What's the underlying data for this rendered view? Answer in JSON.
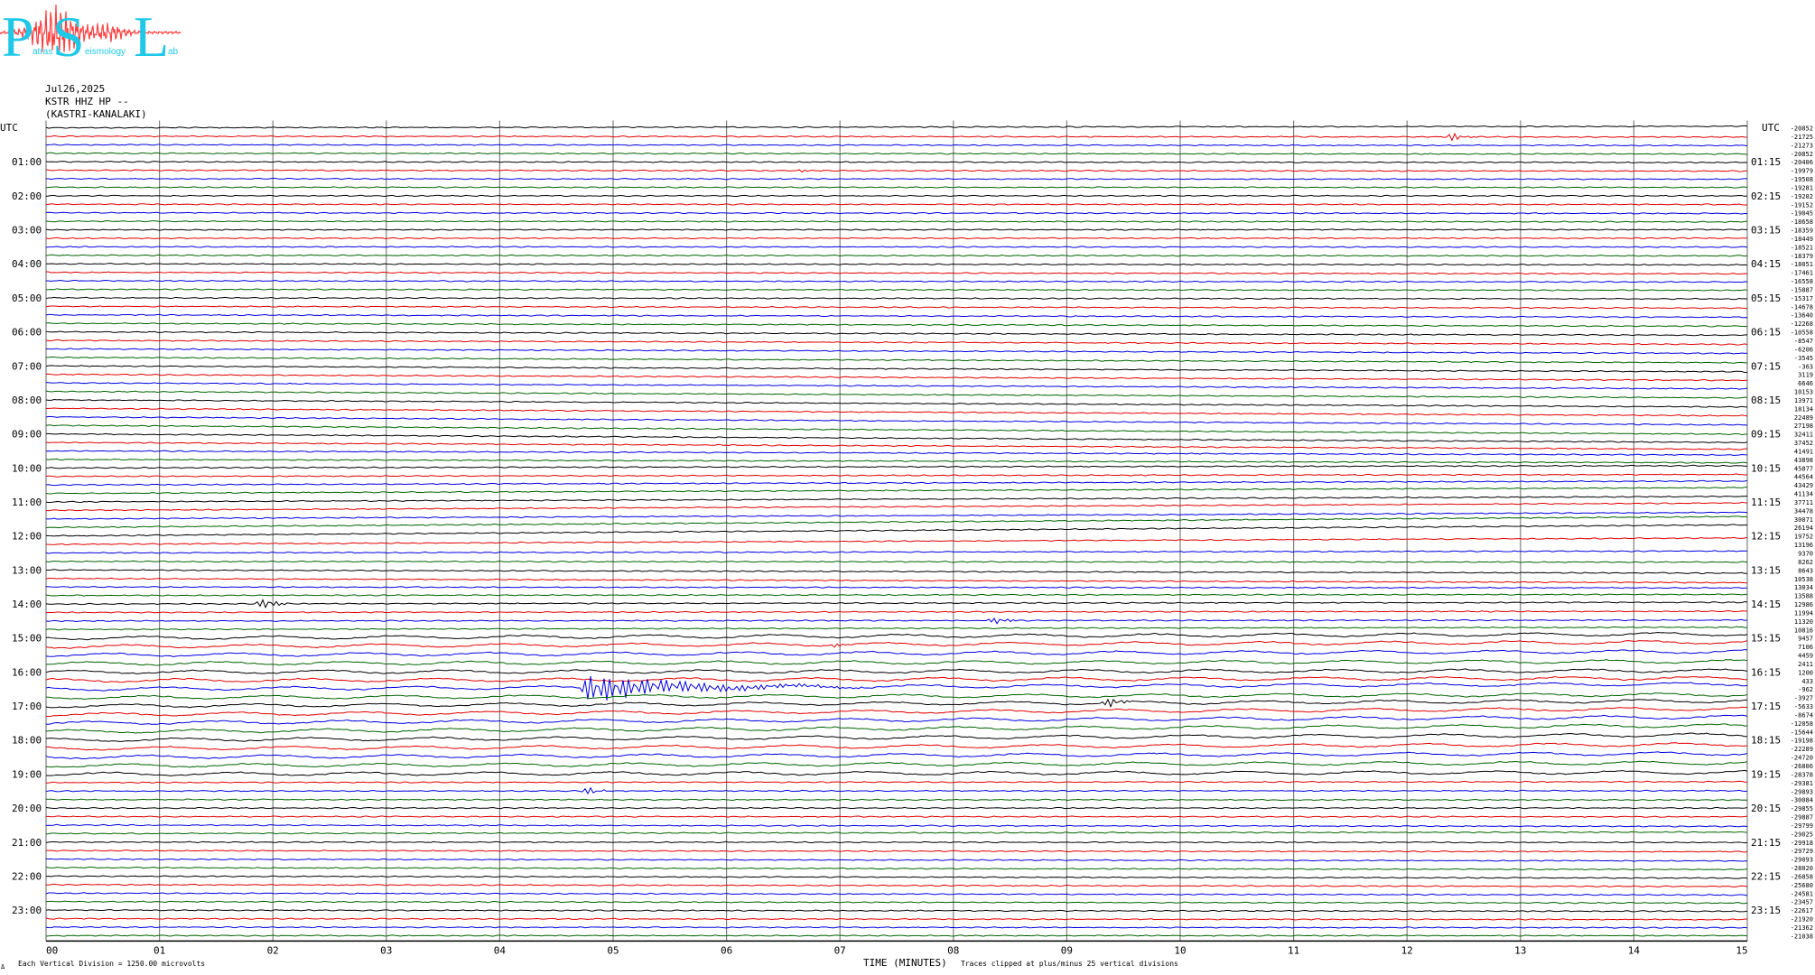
{
  "logo": {
    "big_letters": [
      "P",
      "S",
      "L"
    ],
    "small_words": [
      "atras",
      "eismology",
      "ab"
    ],
    "colors": {
      "letters": "#20c8e8",
      "trace": "#ff4040"
    }
  },
  "header": {
    "date": "Jul26,2025",
    "channel": "KSTR HHZ HP --",
    "station": "(KASTRI-KANALAKI)"
  },
  "footer": {
    "scale_note": "Each Vertical Division = 1250.00 microvolts",
    "axis_title": "TIME (MINUTES)",
    "clip_note": "Traces clipped at plus/minus 25 vertical divisions",
    "corner_mark": "Δ"
  },
  "chart_data": {
    "type": "line",
    "title": "",
    "xlabel": "TIME (MINUTES)",
    "xlim": [
      0,
      15
    ],
    "x_ticks": [
      "00",
      "01",
      "02",
      "03",
      "04",
      "05",
      "06",
      "07",
      "08",
      "09",
      "10",
      "11",
      "12",
      "13",
      "14",
      "15"
    ],
    "left_axis_label": "UTC",
    "right_axis_label": "UTC",
    "left_hour_labels": [
      "01:00",
      "02:00",
      "03:00",
      "04:00",
      "05:00",
      "06:00",
      "07:00",
      "08:00",
      "09:00",
      "10:00",
      "11:00",
      "12:00",
      "13:00",
      "14:00",
      "15:00",
      "16:00",
      "17:00",
      "18:00",
      "19:00",
      "20:00",
      "21:00",
      "22:00",
      "23:00"
    ],
    "right_hour_labels": [
      "01:15",
      "02:15",
      "03:15",
      "04:15",
      "05:15",
      "06:15",
      "07:15",
      "08:15",
      "09:15",
      "10:15",
      "11:15",
      "12:15",
      "13:15",
      "14:15",
      "15:15",
      "16:15",
      "17:15",
      "18:15",
      "19:15",
      "20:15",
      "21:15",
      "22:15",
      "23:15"
    ],
    "trace_colors": [
      "#000000",
      "#e00000",
      "#0000e0",
      "#006400"
    ],
    "grid_color": "#808080",
    "num_traces": 96,
    "trace_offsets": [
      "-20852",
      "-21725",
      "-21273",
      "-20852",
      "-20406",
      "-19979",
      "-19508",
      "-19281",
      "-19202",
      "-19152",
      "-19045",
      "-18658",
      "-18359",
      "-18449",
      "-18521",
      "-18379",
      "-18051",
      "-17461",
      "-16558",
      "-15887",
      "-15317",
      "-14678",
      "-13640",
      "-12268",
      "-10558",
      "-8547",
      "-6206",
      "-3545",
      "-363",
      "3119",
      "6646",
      "10153",
      "13971",
      "18134",
      "22489",
      "27198",
      "32411",
      "37452",
      "41491",
      "43898",
      "45877",
      "44564",
      "43429",
      "41134",
      "37711",
      "34478",
      "30071",
      "26194",
      "19752",
      "13196",
      "9370",
      "8262",
      "8643",
      "10538",
      "13034",
      "13588",
      "12986",
      "11994",
      "11320",
      "10816",
      "9457",
      "7106",
      "4459",
      "2411",
      "1200",
      "433",
      "-962",
      "-3927",
      "-5633",
      "-8674",
      "-12058",
      "-15644",
      "-19198",
      "-22289",
      "-24720",
      "-26806",
      "-28378",
      "-29381",
      "-29893",
      "-30084",
      "-29855",
      "-29887",
      "-29799",
      "-29025",
      "-29918",
      "-29729",
      "-29093",
      "-28020",
      "-26858",
      "-25680",
      "-24581",
      "-23457",
      "-22617",
      "-21920",
      "-21362",
      "-21038"
    ],
    "events": [
      {
        "trace": 1,
        "minute": 12.4,
        "amplitude": 1.6
      },
      {
        "trace": 5,
        "minute": 6.7,
        "amplitude": 0.6
      },
      {
        "trace": 56,
        "minute": 1.95,
        "amplitude": 2.2
      },
      {
        "trace": 58,
        "minute": 8.4,
        "amplitude": 1.4
      },
      {
        "trace": 61,
        "minute": 6.95,
        "amplitude": 0.8
      },
      {
        "trace": 66,
        "minute": 4.8,
        "amplitude": 5.0,
        "duration": 2.5
      },
      {
        "trace": 68,
        "minute": 9.4,
        "amplitude": 1.8
      },
      {
        "trace": 78,
        "minute": 4.8,
        "amplitude": 1.2
      }
    ]
  }
}
